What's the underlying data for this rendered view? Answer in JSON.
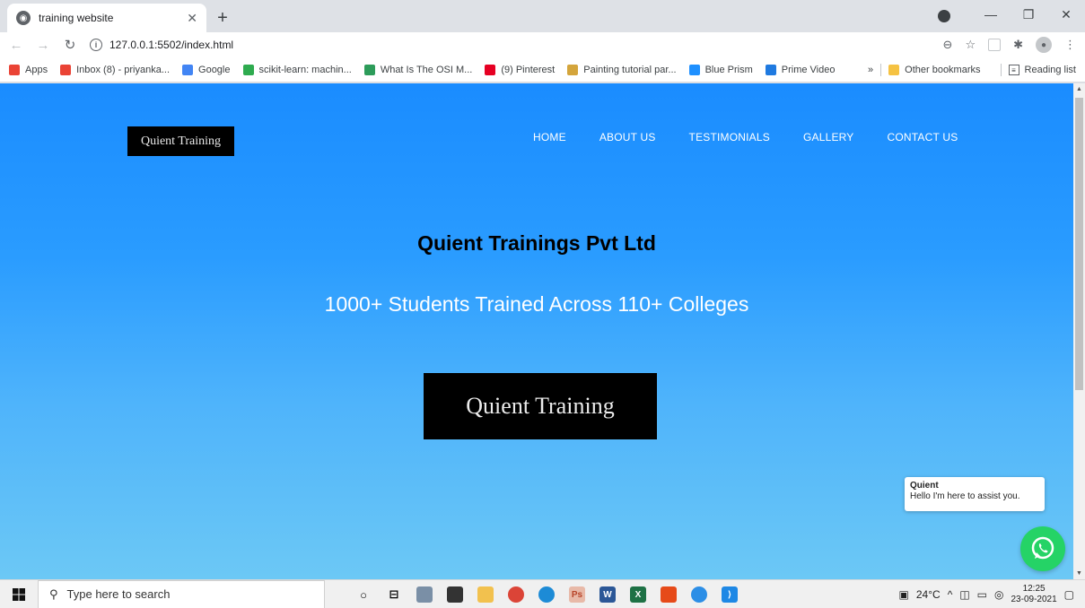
{
  "browser": {
    "tab_title": "training website",
    "url": "127.0.0.1:5502/index.html",
    "bookmarks": [
      {
        "label": "Apps",
        "icon": "apps-grid-icon",
        "color": "#ea4335"
      },
      {
        "label": "Inbox (8) - priyanka...",
        "icon": "gmail-icon",
        "color": "#ea4335"
      },
      {
        "label": "Google",
        "icon": "google-icon",
        "color": "#4285f4"
      },
      {
        "label": "scikit-learn: machin...",
        "icon": "scikit-icon",
        "color": "#2eab4f"
      },
      {
        "label": "What Is The OSI M...",
        "icon": "osi-icon",
        "color": "#2d9c5a"
      },
      {
        "label": "(9) Pinterest",
        "icon": "pinterest-icon",
        "color": "#e60023"
      },
      {
        "label": "Painting tutorial par...",
        "icon": "painting-icon",
        "color": "#d4a53c"
      },
      {
        "label": "Blue Prism",
        "icon": "blue-prism-icon",
        "color": "#1e90ff"
      },
      {
        "label": "Prime Video",
        "icon": "prime-video-icon",
        "color": "#1f7ae0"
      }
    ],
    "more_bookmarks": "»",
    "other_bookmarks": "Other bookmarks",
    "reading_list": "Reading list"
  },
  "site": {
    "logo_text": "Quient Training",
    "nav": [
      "HOME",
      "ABOUT US",
      "TESTIMONIALS",
      "GALLERY",
      "CONTACT US"
    ],
    "hero_title": "Quient Trainings Pvt Ltd",
    "hero_subtitle": "1000+ Students Trained Across 110+ Colleges",
    "big_logo_text": "Quient Training",
    "chat_name": "Quient",
    "chat_message": "Hello I'm here to assist you.",
    "gradient_top": "#1a8cff",
    "gradient_bottom": "#6cc8f5",
    "whatsapp_color": "#25d366"
  },
  "taskbar": {
    "search_placeholder": "Type here to search",
    "weather": "24°C",
    "time": "12:25",
    "date": "23-09-2021"
  }
}
